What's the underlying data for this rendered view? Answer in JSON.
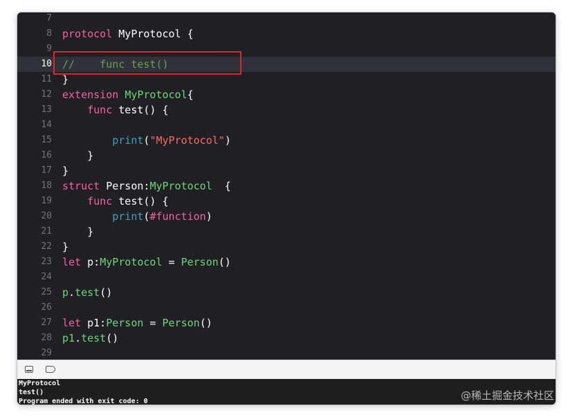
{
  "editor": {
    "current_line": "10",
    "lines": [
      {
        "n": "7",
        "tokens": []
      },
      {
        "n": "8",
        "tokens": [
          {
            "t": "protocol",
            "c": "kw"
          },
          {
            "t": " MyProtocol {",
            "c": "pl"
          }
        ]
      },
      {
        "n": "9",
        "tokens": []
      },
      {
        "n": "10",
        "tokens": [
          {
            "t": "//    func test()",
            "c": "cm"
          }
        ]
      },
      {
        "n": "11",
        "tokens": [
          {
            "t": "}",
            "c": "pl"
          }
        ]
      },
      {
        "n": "12",
        "tokens": [
          {
            "t": "extension",
            "c": "kw"
          },
          {
            "t": " ",
            "c": "pl"
          },
          {
            "t": "MyProtocol",
            "c": "proj"
          },
          {
            "t": "{",
            "c": "pl"
          }
        ]
      },
      {
        "n": "13",
        "tokens": [
          {
            "t": "    ",
            "c": "pl"
          },
          {
            "t": "func",
            "c": "kw"
          },
          {
            "t": " test() {",
            "c": "pl"
          }
        ]
      },
      {
        "n": "14",
        "tokens": []
      },
      {
        "n": "15",
        "tokens": [
          {
            "t": "        ",
            "c": "pl"
          },
          {
            "t": "print",
            "c": "fn"
          },
          {
            "t": "(",
            "c": "pl"
          },
          {
            "t": "\"MyProtocol\"",
            "c": "str"
          },
          {
            "t": ")",
            "c": "pl"
          }
        ]
      },
      {
        "n": "16",
        "tokens": [
          {
            "t": "    }",
            "c": "pl"
          }
        ]
      },
      {
        "n": "17",
        "tokens": [
          {
            "t": "}",
            "c": "pl"
          }
        ]
      },
      {
        "n": "18",
        "tokens": [
          {
            "t": "struct",
            "c": "kw"
          },
          {
            "t": " Person:",
            "c": "pl"
          },
          {
            "t": "MyProtocol",
            "c": "proj"
          },
          {
            "t": "  {",
            "c": "pl"
          }
        ]
      },
      {
        "n": "19",
        "tokens": [
          {
            "t": "    ",
            "c": "pl"
          },
          {
            "t": "func",
            "c": "kw"
          },
          {
            "t": " test() {",
            "c": "pl"
          }
        ]
      },
      {
        "n": "20",
        "tokens": [
          {
            "t": "        ",
            "c": "pl"
          },
          {
            "t": "print",
            "c": "fn"
          },
          {
            "t": "(",
            "c": "pl"
          },
          {
            "t": "#function",
            "c": "kw"
          },
          {
            "t": ")",
            "c": "pl"
          }
        ]
      },
      {
        "n": "21",
        "tokens": [
          {
            "t": "    }",
            "c": "pl"
          }
        ]
      },
      {
        "n": "22",
        "tokens": [
          {
            "t": "}",
            "c": "pl"
          }
        ]
      },
      {
        "n": "23",
        "tokens": [
          {
            "t": "let",
            "c": "kw"
          },
          {
            "t": " p:",
            "c": "pl"
          },
          {
            "t": "MyProtocol",
            "c": "proj"
          },
          {
            "t": " = ",
            "c": "pl"
          },
          {
            "t": "Person",
            "c": "proj"
          },
          {
            "t": "()",
            "c": "pl"
          }
        ]
      },
      {
        "n": "24",
        "tokens": []
      },
      {
        "n": "25",
        "tokens": [
          {
            "t": "p",
            "c": "proj"
          },
          {
            "t": ".",
            "c": "pl"
          },
          {
            "t": "test",
            "c": "proj"
          },
          {
            "t": "()",
            "c": "pl"
          }
        ]
      },
      {
        "n": "26",
        "tokens": []
      },
      {
        "n": "27",
        "tokens": [
          {
            "t": "let",
            "c": "kw"
          },
          {
            "t": " p1:",
            "c": "pl"
          },
          {
            "t": "Person",
            "c": "proj"
          },
          {
            "t": " = ",
            "c": "pl"
          },
          {
            "t": "Person",
            "c": "proj"
          },
          {
            "t": "()",
            "c": "pl"
          }
        ]
      },
      {
        "n": "28",
        "tokens": [
          {
            "t": "p1",
            "c": "proj"
          },
          {
            "t": ".",
            "c": "pl"
          },
          {
            "t": "test",
            "c": "proj"
          },
          {
            "t": "()",
            "c": "pl"
          }
        ]
      },
      {
        "n": "29",
        "tokens": []
      }
    ]
  },
  "toolbar": {
    "icons": [
      "console-toggle-icon",
      "tag-icon"
    ]
  },
  "console": {
    "lines": [
      "MyProtocol",
      "test()",
      "Program ended with exit code: 0"
    ]
  },
  "watermark": "@稀土掘金技术社区",
  "colors": {
    "editor_bg": "#1f1f24",
    "keyword": "#fc5fa3",
    "function": "#41a1c0",
    "project_type": "#6bd87a",
    "string": "#fc6a5d",
    "comment": "#6c9f53",
    "highlight_box": "#e0252b"
  }
}
